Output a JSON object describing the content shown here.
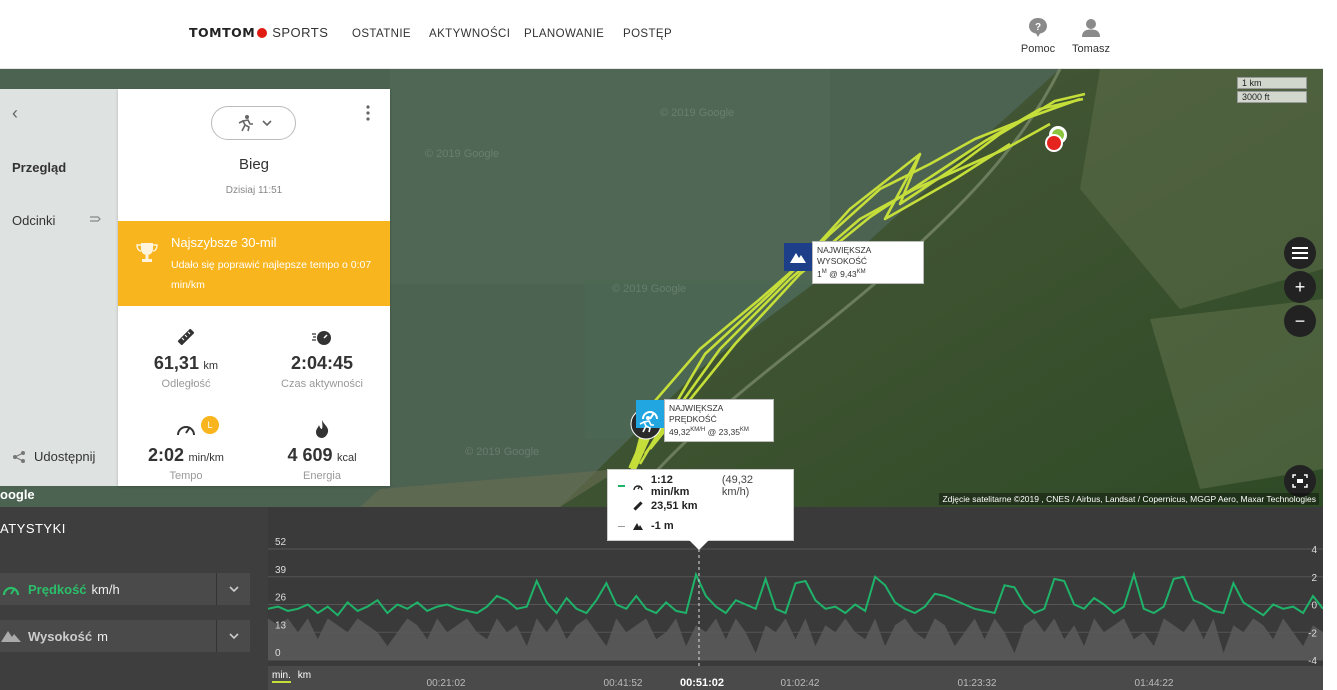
{
  "header": {
    "brand": "TOMTOM",
    "brand_suffix": "SPORTS",
    "nav": [
      {
        "label": "OSTATNIE"
      },
      {
        "label": "AKTYWNOŚCI"
      },
      {
        "label": "PLANOWANIE"
      },
      {
        "label": "POSTĘP"
      }
    ],
    "help_label": "Pomoc",
    "user_label": "Tomasz"
  },
  "sidebar": {
    "items": [
      {
        "label": "Przegląd"
      },
      {
        "label": "Odcinki"
      }
    ],
    "share_label": "Udostępnij"
  },
  "activity": {
    "sport_icon": "running-icon",
    "title": "Bieg",
    "date": "Dzisiaj 11:51",
    "record": {
      "title": "Najszybsze 30-mil",
      "text": "Udało się poprawić najlepsze tempo o 0:07 min/km"
    },
    "stats": [
      {
        "icon": "ruler-icon",
        "value": "61,31",
        "unit": "km",
        "label": "Odległość"
      },
      {
        "icon": "stopwatch-icon",
        "value": "2:04:45",
        "unit": "",
        "label": "Czas aktywności"
      },
      {
        "icon": "speedometer-icon",
        "value": "2:02",
        "unit": "min/km",
        "label": "Tempo",
        "badge": "L"
      },
      {
        "icon": "flame-icon",
        "value": "4 609",
        "unit": "kcal",
        "label": "Energia"
      }
    ]
  },
  "map": {
    "scale_km": "1 km",
    "scale_ft": "3000 ft",
    "attribution": "Zdjęcie satelitarne ©2019 , CNES / Airbus, Landsat / Copernicus, MGGP Aero, Maxar Technologies",
    "google_label": "oogle",
    "watermarks": [
      "© 2019 Google",
      "© 2019 Google",
      "© 2019 Google",
      "© 2019 Google"
    ],
    "max_altitude": {
      "title": "NAJWIĘKSZA WYSOKOŚĆ",
      "value": "1",
      "value_unit": "M",
      "at": "@ 9,43",
      "at_unit": "KM"
    },
    "max_speed": {
      "title": "NAJWIĘKSZA PRĘDKOŚĆ",
      "value": "49,32",
      "value_unit": "KM/H",
      "at": "@ 23,35",
      "at_unit": "KM"
    },
    "route_color": "#c5de3a"
  },
  "stats_panel": {
    "title": "ATYSTYKI",
    "metrics": [
      {
        "name": "Prędkość",
        "unit": "km/h",
        "color": "#2bbf6a"
      },
      {
        "name": "Wysokość",
        "unit": "m",
        "color": "#cccccc"
      }
    ],
    "x_axis_unit_toggle": [
      "min.",
      "km"
    ]
  },
  "tooltip": {
    "pace": "1:12 min/km",
    "speed": "(49,32 km/h)",
    "distance": "23,51 km",
    "altitude": "-1 m"
  },
  "chart_data": {
    "type": "line",
    "title": "",
    "xlabel": "",
    "ylabel": "",
    "x_ticks": [
      "00:21:02",
      "00:41:52",
      "00:51:02",
      "01:02:42",
      "01:23:32",
      "01:44:22"
    ],
    "highlight_tick": "00:51:02",
    "y_left_ticks": [
      0,
      13,
      26,
      39,
      52
    ],
    "y_right_ticks": [
      -4,
      -2,
      0,
      2,
      4
    ],
    "ylim": [
      0,
      52
    ],
    "y2lim": [
      -4,
      4
    ],
    "series": [
      {
        "name": "Prędkość",
        "axis": "left",
        "color": "#1fb36a",
        "values": [
          24,
          25,
          23,
          24,
          26,
          22,
          25,
          21,
          27,
          23,
          25,
          28,
          22,
          26,
          24,
          27,
          23,
          25,
          26,
          24,
          23,
          22,
          25,
          30,
          28,
          24,
          25,
          37,
          27,
          22,
          29,
          24,
          22,
          28,
          36,
          26,
          24,
          30,
          24,
          22,
          27,
          23,
          22,
          40,
          30,
          25,
          22,
          28,
          26,
          24,
          38,
          24,
          22,
          36,
          37,
          28,
          24,
          25,
          22,
          26,
          23,
          39,
          35,
          27,
          24,
          22,
          25,
          31,
          30,
          28,
          26,
          24,
          23,
          22,
          35,
          34,
          26,
          22,
          24,
          38,
          37,
          26,
          24,
          29,
          26,
          22,
          25,
          40,
          24,
          22,
          25,
          38,
          39,
          28,
          26,
          23,
          22,
          36,
          27,
          24,
          21,
          26,
          24,
          25,
          22,
          30,
          24
        ]
      },
      {
        "name": "Wysokość",
        "axis": "right",
        "color": "#5a5a5a",
        "values": [
          -1,
          -1.5,
          -1,
          -2,
          -1,
          -2.5,
          -1,
          -1.5,
          -2,
          -1,
          -1.5,
          -2,
          -3,
          -2,
          -1,
          -1.5,
          -2.5,
          -1,
          -2,
          -1.5,
          -1,
          -2,
          -2.5,
          -1,
          -2,
          -1.5,
          -3,
          -1,
          -2,
          -1,
          -2.5,
          -1.5,
          -1,
          -2,
          -3,
          -1,
          -2,
          -1.5,
          -1,
          -2.5,
          -2,
          -1,
          -3,
          -1.5,
          -2,
          -1,
          -2.5,
          -1,
          -2,
          -3.5,
          -1.5,
          -2,
          -1,
          -2.5,
          -1,
          -3,
          -1.5,
          -2,
          -1,
          -2,
          -2.5,
          -1,
          -3,
          -1.5,
          -1,
          -2,
          -2.5,
          -1,
          -1.5,
          -3,
          -2,
          -1,
          -2.5,
          -1,
          -2,
          -3.5,
          -1.5,
          -1,
          -2,
          -1,
          -2.5,
          -1.5,
          -3,
          -1,
          -2,
          -1.5,
          -1,
          -2.5,
          -2,
          -3,
          -1,
          -1.5,
          -2,
          -1,
          -2.5,
          -1,
          -3.5,
          -1.5,
          -2,
          -1,
          -1.5,
          -2.5,
          -1,
          -2,
          -3,
          -1.5,
          -2
        ]
      }
    ]
  }
}
